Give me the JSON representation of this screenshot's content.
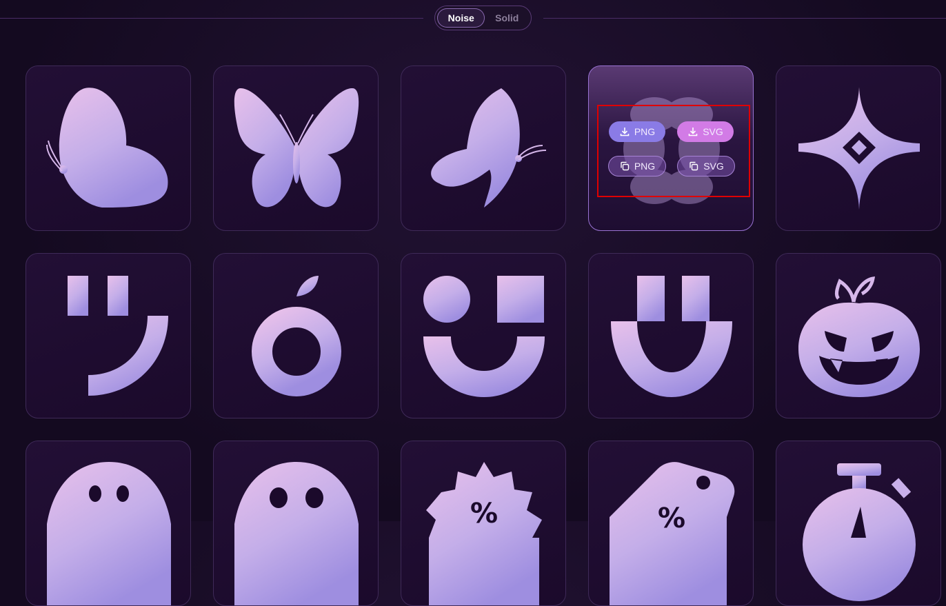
{
  "style_toggle": {
    "options": [
      "Noise",
      "Solid"
    ],
    "selected": "Noise"
  },
  "hover_actions": {
    "download_png": "PNG",
    "download_svg": "SVG",
    "copy_png": "PNG",
    "copy_svg": "SVG"
  },
  "icons": [
    "butterfly-side-left-icon",
    "butterfly-front-icon",
    "butterfly-side-right-icon",
    "flower-icon",
    "sparkle-star-icon",
    "wink-face-icon",
    "apple-ring-icon",
    "circle-square-smile-icon",
    "u-smile-icon",
    "jack-o-lantern-icon",
    "ghost-icon",
    "ghost-skull-icon",
    "discount-badge-icon",
    "price-tag-icon",
    "stopwatch-icon"
  ],
  "colors": {
    "accent_light": "#e8c0ea",
    "accent_mid": "#b9a0e8",
    "accent_dark": "#9e8ee0",
    "download_blue": "#8a7be6",
    "download_pink": "#d27be6",
    "highlight_red": "#e00000"
  }
}
